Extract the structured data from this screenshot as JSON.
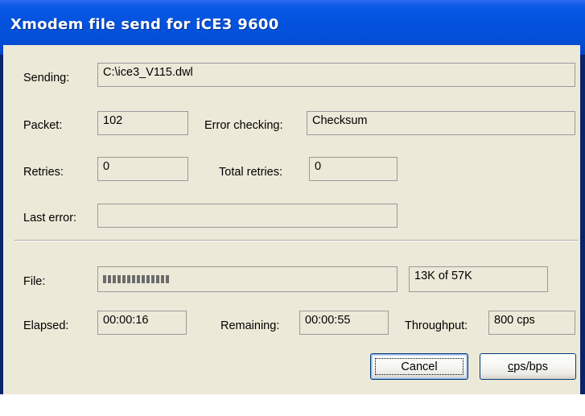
{
  "window": {
    "title": "Xmodem file send for iCE3 9600"
  },
  "fields": {
    "sending": {
      "label": "Sending:",
      "value": "C:\\ice3_V115.dwl"
    },
    "packet": {
      "label": "Packet:",
      "value": "102"
    },
    "error_checking": {
      "label": "Error checking:",
      "value": "Checksum"
    },
    "retries": {
      "label": "Retries:",
      "value": "0"
    },
    "total_retries": {
      "label": "Total retries:",
      "value": "0"
    },
    "last_error": {
      "label": "Last error:",
      "value": ""
    }
  },
  "progress": {
    "file_label": "File:",
    "fraction": 0.23,
    "text": "13K of 57K"
  },
  "stats": {
    "elapsed": {
      "label": "Elapsed:",
      "value": "00:00:16"
    },
    "remaining": {
      "label": "Remaining:",
      "value": "00:00:55"
    },
    "throughput": {
      "label": "Throughput:",
      "value": "800 cps"
    }
  },
  "buttons": {
    "cancel": "Cancel",
    "cps_bps_accel": "c",
    "cps_bps_rest": "ps/bps"
  }
}
